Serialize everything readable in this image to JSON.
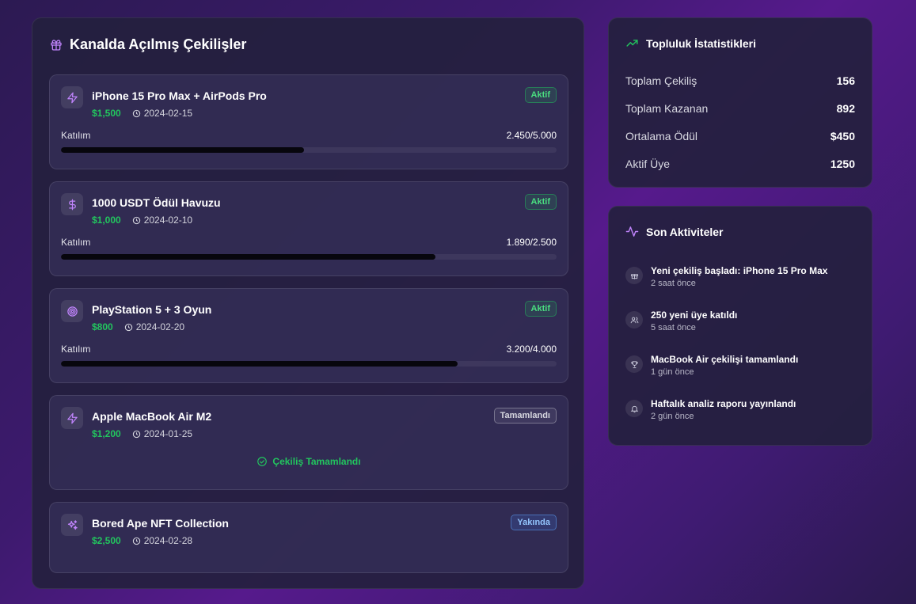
{
  "giveaways": {
    "title": "Kanalda Açılmış Çekilişler",
    "participation_label": "Katılım",
    "completed_text": "Çekiliş Tamamlandı",
    "items": [
      {
        "title": "iPhone 15 Pro Max + AirPods Pro",
        "prize": "$1,500",
        "date": "2024-02-15",
        "status": "Aktif",
        "icon": "zap-icon",
        "progress_text": "2.450/5.000",
        "progress": 0.49
      },
      {
        "title": "1000 USDT Ödül Havuzu",
        "prize": "$1,000",
        "date": "2024-02-10",
        "status": "Aktif",
        "icon": "dollar-icon",
        "progress_text": "1.890/2.500",
        "progress": 0.756
      },
      {
        "title": "PlayStation 5 + 3 Oyun",
        "prize": "$800",
        "date": "2024-02-20",
        "status": "Aktif",
        "icon": "target-icon",
        "progress_text": "3.200/4.000",
        "progress": 0.8
      },
      {
        "title": "Apple MacBook Air M2",
        "prize": "$1,200",
        "date": "2024-01-25",
        "status": "Tamamlandı",
        "icon": "zap-icon"
      },
      {
        "title": "Bored Ape NFT Collection",
        "prize": "$2,500",
        "date": "2024-02-28",
        "status": "Yakında",
        "icon": "sparkles-icon"
      }
    ]
  },
  "stats": {
    "title": "Topluluk İstatistikleri",
    "rows": [
      {
        "label": "Toplam Çekiliş",
        "value": "156"
      },
      {
        "label": "Toplam Kazanan",
        "value": "892"
      },
      {
        "label": "Ortalama Ödül",
        "value": "$450"
      },
      {
        "label": "Aktif Üye",
        "value": "1250"
      }
    ]
  },
  "activities": {
    "title": "Son Aktiviteler",
    "items": [
      {
        "text": "Yeni çekiliş başladı: iPhone 15 Pro Max",
        "time": "2 saat önce",
        "icon": "gift-icon"
      },
      {
        "text": "250 yeni üye katıldı",
        "time": "5 saat önce",
        "icon": "users-icon"
      },
      {
        "text": "MacBook Air çekilişi tamamlandı",
        "time": "1 gün önce",
        "icon": "trophy-icon"
      },
      {
        "text": "Haftalık analiz raporu yayınlandı",
        "time": "2 gün önce",
        "icon": "bell-icon"
      }
    ]
  },
  "colors": {
    "accent_purple": "#a855f7",
    "prize_green": "#22c55e",
    "trend_green": "#22c55e"
  }
}
